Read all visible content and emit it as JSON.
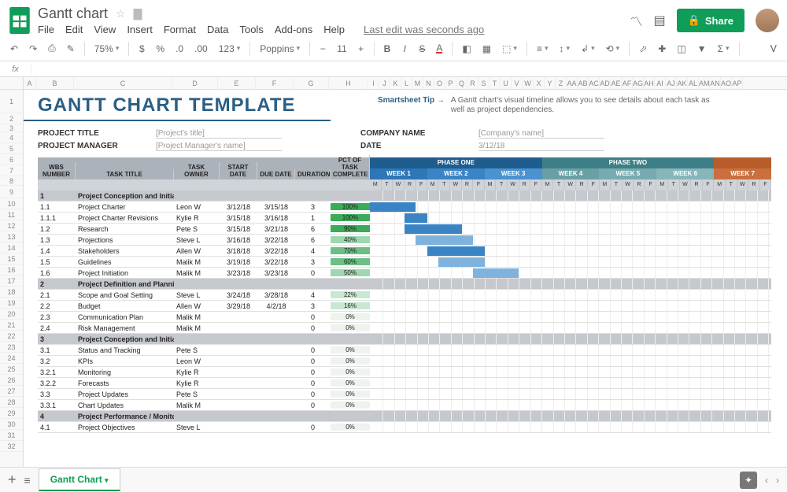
{
  "doc_title": "Gantt chart",
  "menus": [
    "File",
    "Edit",
    "View",
    "Insert",
    "Format",
    "Data",
    "Tools",
    "Add-ons",
    "Help"
  ],
  "last_edit": "Last edit was seconds ago",
  "share": "Share",
  "toolbar": {
    "zoom": "75%",
    "font": "Poppins",
    "size": "11",
    "number_fmt": "123"
  },
  "columns": [
    "A",
    "B",
    "C",
    "D",
    "E",
    "F",
    "G",
    "H",
    "I",
    "J",
    "K",
    "L",
    "M",
    "N",
    "O",
    "P",
    "Q",
    "R",
    "S",
    "T",
    "U",
    "V",
    "W",
    "X",
    "Y",
    "Z",
    "AA",
    "AB",
    "AC",
    "AD",
    "AE",
    "AF",
    "AG",
    "AH",
    "AI",
    "AJ",
    "AK",
    "AL",
    "AM",
    "AN",
    "AO",
    "AP"
  ],
  "row_start": 1,
  "row_end": 32,
  "template": {
    "title": "GANTT CHART TEMPLATE",
    "tip_label": "Smartsheet Tip →",
    "tip_text": "A Gantt chart's visual timeline allows you to see details about each task as well as project dependencies.",
    "meta": {
      "project_title_label": "PROJECT TITLE",
      "project_title_val": "[Project's title]",
      "project_manager_label": "PROJECT MANAGER",
      "project_manager_val": "[Project Manager's name]",
      "company_label": "COMPANY NAME",
      "company_val": "[Company's name]",
      "date_label": "DATE",
      "date_val": "3/12/18"
    },
    "headers": {
      "wbs": "WBS NUMBER",
      "title": "TASK TITLE",
      "owner": "TASK OWNER",
      "start": "START DATE",
      "due": "DUE DATE",
      "dur": "DURATION",
      "pct": "PCT OF TASK COMPLETE"
    },
    "phases": [
      {
        "label": "PHASE ONE",
        "color": "#1f5d8f",
        "weeks": [
          {
            "label": "WEEK 1",
            "color": "#2e76b6"
          },
          {
            "label": "WEEK 2",
            "color": "#3a84c6"
          },
          {
            "label": "WEEK 3",
            "color": "#4a92d0"
          }
        ]
      },
      {
        "label": "PHASE TWO",
        "color": "#3d7f86",
        "weeks": [
          {
            "label": "WEEK 4",
            "color": "#6aa0a5"
          },
          {
            "label": "WEEK 5",
            "color": "#78abaf"
          },
          {
            "label": "WEEK 6",
            "color": "#86b6ba"
          }
        ]
      },
      {
        "label": "",
        "color": "#b85c2b",
        "weeks": [
          {
            "label": "WEEK 7",
            "color": "#c9703e"
          }
        ]
      }
    ],
    "days": [
      "M",
      "T",
      "W",
      "R",
      "F"
    ],
    "rows": [
      {
        "section": true,
        "wbs": "1",
        "title": "Project Conception and Initiation"
      },
      {
        "wbs": "1.1",
        "title": "Project Charter",
        "owner": "Leon W",
        "start": "3/12/18",
        "due": "3/15/18",
        "dur": "3",
        "pct": 100,
        "bar_start": 0,
        "bar_len": 4,
        "bar_color": "#3a84c6"
      },
      {
        "wbs": "1.1.1",
        "title": "Project Charter Revisions",
        "owner": "Kylie R",
        "start": "3/15/18",
        "due": "3/16/18",
        "dur": "1",
        "pct": 100,
        "bar_start": 3,
        "bar_len": 2,
        "bar_color": "#3a84c6"
      },
      {
        "wbs": "1.2",
        "title": "Research",
        "owner": "Pete S",
        "start": "3/15/18",
        "due": "3/21/18",
        "dur": "6",
        "pct": 90,
        "bar_start": 3,
        "bar_len": 5,
        "bar_color": "#3a84c6"
      },
      {
        "wbs": "1.3",
        "title": "Projections",
        "owner": "Steve L",
        "start": "3/16/18",
        "due": "3/22/18",
        "dur": "6",
        "pct": 40,
        "bar_start": 4,
        "bar_len": 5,
        "bar_color": "#7fb3de"
      },
      {
        "wbs": "1.4",
        "title": "Stakeholders",
        "owner": "Allen W",
        "start": "3/18/18",
        "due": "3/22/18",
        "dur": "4",
        "pct": 70,
        "bar_start": 5,
        "bar_len": 5,
        "bar_color": "#3a84c6"
      },
      {
        "wbs": "1.5",
        "title": "Guidelines",
        "owner": "Malik M",
        "start": "3/19/18",
        "due": "3/22/18",
        "dur": "3",
        "pct": 60,
        "bar_start": 6,
        "bar_len": 4,
        "bar_color": "#7fb3de"
      },
      {
        "wbs": "1.6",
        "title": "Project Initiation",
        "owner": "Malik M",
        "start": "3/23/18",
        "due": "3/23/18",
        "dur": "0",
        "pct": 50,
        "bar_start": 9,
        "bar_len": 4,
        "bar_color": "#7fb3de"
      },
      {
        "section": true,
        "wbs": "2",
        "title": "Project Definition and Planning"
      },
      {
        "wbs": "2.1",
        "title": "Scope and Goal Setting",
        "owner": "Steve L",
        "start": "3/24/18",
        "due": "3/28/18",
        "dur": "4",
        "pct": 22
      },
      {
        "wbs": "2.2",
        "title": "Budget",
        "owner": "Allen W",
        "start": "3/29/18",
        "due": "4/2/18",
        "dur": "3",
        "pct": 16
      },
      {
        "wbs": "2.3",
        "title": "Communication Plan",
        "owner": "Malik M",
        "start": "",
        "due": "",
        "dur": "0",
        "pct": 0
      },
      {
        "wbs": "2.4",
        "title": "Risk Management",
        "owner": "Malik M",
        "start": "",
        "due": "",
        "dur": "0",
        "pct": 0
      },
      {
        "section": true,
        "wbs": "3",
        "title": "Project Conception and Initiation"
      },
      {
        "wbs": "3.1",
        "title": "Status and Tracking",
        "owner": "Pete S",
        "start": "",
        "due": "",
        "dur": "0",
        "pct": 0
      },
      {
        "wbs": "3.2",
        "title": "KPIs",
        "owner": "Leon W",
        "start": "",
        "due": "",
        "dur": "0",
        "pct": 0
      },
      {
        "wbs": "3.2.1",
        "title": "Monitoring",
        "owner": "Kylie R",
        "start": "",
        "due": "",
        "dur": "0",
        "pct": 0
      },
      {
        "wbs": "3.2.2",
        "title": "Forecasts",
        "owner": "Kylie R",
        "start": "",
        "due": "",
        "dur": "0",
        "pct": 0
      },
      {
        "wbs": "3.3",
        "title": "Project Updates",
        "owner": "Pete S",
        "start": "",
        "due": "",
        "dur": "0",
        "pct": 0
      },
      {
        "wbs": "3.3.1",
        "title": "Chart Updates",
        "owner": "Malik M",
        "start": "",
        "due": "",
        "dur": "0",
        "pct": 0
      },
      {
        "section": true,
        "wbs": "4",
        "title": "Project Performance / Monitoring"
      },
      {
        "wbs": "4.1",
        "title": "Project Objectives",
        "owner": "Steve L",
        "start": "",
        "due": "",
        "dur": "0",
        "pct": 0
      }
    ]
  },
  "sheet_tab": "Gantt Chart"
}
